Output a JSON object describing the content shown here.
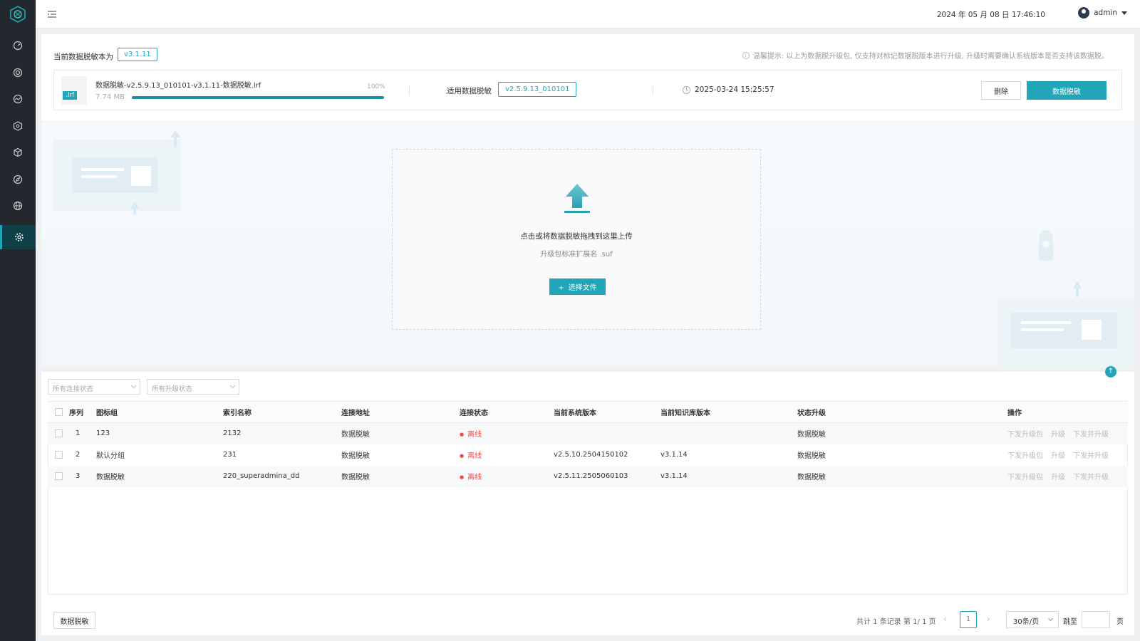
{
  "topbar": {
    "datetime": "2024 年 05 月 08 日 17:46:10",
    "username": "admin"
  },
  "sidebar": {
    "items": [
      {
        "icon": "dashboard-icon"
      },
      {
        "icon": "target-icon"
      },
      {
        "icon": "monitor-icon"
      },
      {
        "icon": "hexagon-icon"
      },
      {
        "icon": "cube-icon"
      },
      {
        "icon": "compass-icon"
      },
      {
        "icon": "globe-icon"
      },
      {
        "icon": "gear-icon",
        "active": true
      }
    ]
  },
  "current": {
    "label": "当前数据脱敏本为",
    "version": "v3.1.11",
    "tip": "温馨提示: 以上为数据脱升级包, 仅支持对标记数据脱版本进行升级, 升级时需要确认系统版本是否支持该数据脱。"
  },
  "file": {
    "ext": ".lrf",
    "name": "数据脱敏-v2.5.9.13_010101-v3.1.11-数据脱敏.lrf",
    "size": "7.74 MB",
    "progress_label": "100%",
    "progress": 1.0,
    "apply_label": "适用数据脱敏",
    "apply_version": "v2.5.9.13_010101",
    "time": "2025-03-24 15:25:57",
    "delete_label": "删除",
    "action_label": "数据脱敏"
  },
  "upload": {
    "text": "点击或将数据脱敏拖拽到这里上传",
    "sub": "升级包标准扩展名 .suf",
    "button": "选择文件",
    "plus": "+"
  },
  "filters": {
    "connect_placeholder": "所有连接状态",
    "upgrade_placeholder": "所有升级状态"
  },
  "table": {
    "headers": [
      "序列",
      "图标组",
      "索引名称",
      "连接地址",
      "连接状态",
      "当前系统版本",
      "当前知识库版本",
      "状态升级",
      "操作"
    ],
    "rows": [
      {
        "seq": "1",
        "group": "123",
        "index": "2132",
        "addr": "数据脱敏",
        "status": "离线",
        "sys": "",
        "kb": "",
        "upgrade": "数据脱敏",
        "ops": [
          "下发升级包",
          "升级",
          "下发并升级"
        ]
      },
      {
        "seq": "2",
        "group": "默认分组",
        "index": "231",
        "addr": "数据脱敏",
        "status": "离线",
        "sys": "v2.5.10.2504150102",
        "kb": "v3.1.14",
        "upgrade": "数据脱敏",
        "ops": [
          "下发升级包",
          "升级",
          "下发并升级"
        ]
      },
      {
        "seq": "3",
        "group": "数据脱敏",
        "index": "220_superadmina_dd",
        "addr": "数据脱敏",
        "status": "离线",
        "sys": "v2.5.11.2505060103",
        "kb": "v3.1.14",
        "upgrade": "数据脱敏",
        "ops": [
          "下发升级包",
          "升级",
          "下发并升级"
        ]
      }
    ]
  },
  "footer": {
    "button": "数据脱敏",
    "summary": "共计 1 条记录 第 1/ 1 页",
    "page": "1",
    "page_size": "30条/页",
    "goto": "跳至",
    "unit": "页",
    "prev": "‹",
    "next": "›"
  },
  "colors": {
    "accent": "#21a5b8",
    "sidebar": "#22282e",
    "danger": "#e84b4b"
  }
}
